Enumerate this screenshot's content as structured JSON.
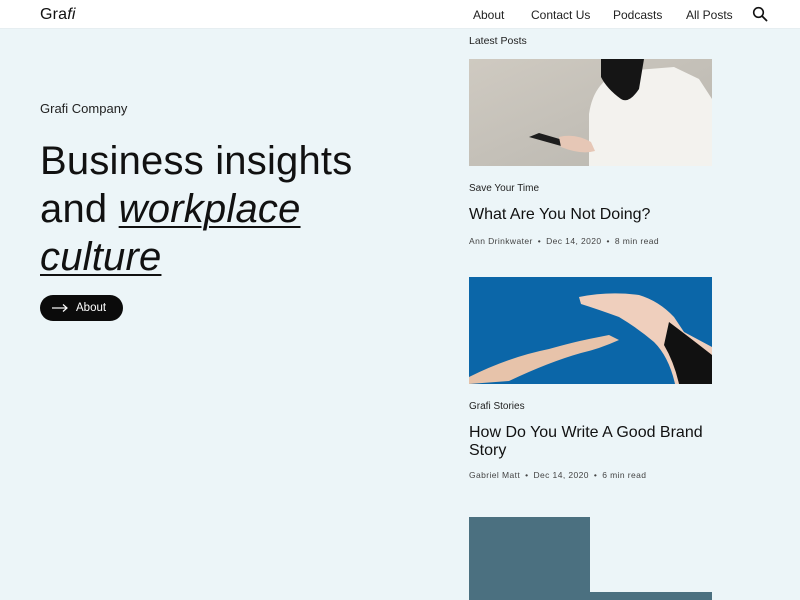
{
  "brand": {
    "part1": "Gra",
    "part2": "fi"
  },
  "nav": {
    "items": [
      "About",
      "Contact Us",
      "Podcasts",
      "All Posts"
    ]
  },
  "icons": {
    "search": "search-icon",
    "arrow": "arrow-right-icon"
  },
  "hero": {
    "eyebrow": "Grafi Company",
    "line1": "Business insights",
    "line2_prefix": "and ",
    "line2_em": "workplace",
    "line3_em": "culture",
    "button_label": "About"
  },
  "latest": {
    "heading": "Latest Posts",
    "posts": [
      {
        "category": "Save Your Time",
        "title": "What Are You Not Doing?",
        "author": "Ann Drinkwater",
        "date": "Dec 14, 2020",
        "read": "8 min read"
      },
      {
        "category": "Grafi Stories",
        "title": "How Do You Write A Good Brand Story",
        "author": "Gabriel Matt",
        "date": "Dec 14, 2020",
        "read": "6 min read"
      }
    ]
  },
  "colors": {
    "background": "#ecf5f8",
    "header": "#ffffff",
    "button": "#0b0b0b",
    "img2_bg": "#0b66a8",
    "img3_bg": "#4b7080"
  }
}
